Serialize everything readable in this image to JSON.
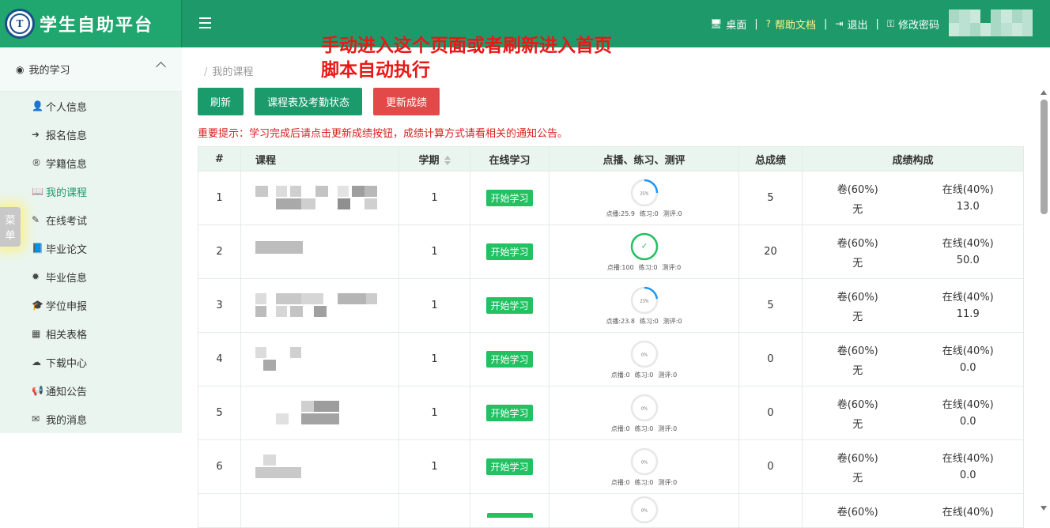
{
  "app": {
    "title": "学生自助平台",
    "logo_text": "T"
  },
  "topnav": {
    "desktop": "桌面",
    "help": "帮助文档",
    "logout": "退出",
    "change_password": "修改密码",
    "separator": "|"
  },
  "sidebar": {
    "section": "我的学习",
    "items": [
      {
        "label": "个人信息",
        "icon": "user-icon",
        "glyph": "👤"
      },
      {
        "label": "报名信息",
        "icon": "sign-in-icon",
        "glyph": "➜"
      },
      {
        "label": "学籍信息",
        "icon": "registered-icon",
        "glyph": "®"
      },
      {
        "label": "我的课程",
        "icon": "book-open-icon",
        "glyph": "📖"
      },
      {
        "label": "在线考试",
        "icon": "pencil-icon",
        "glyph": "✎"
      },
      {
        "label": "毕业论文",
        "icon": "book-icon",
        "glyph": "📘"
      },
      {
        "label": "毕业信息",
        "icon": "certificate-icon",
        "glyph": "✹"
      },
      {
        "label": "学位申报",
        "icon": "graduation-cap-icon",
        "glyph": "🎓"
      },
      {
        "label": "相关表格",
        "icon": "table-icon",
        "glyph": "▦"
      },
      {
        "label": "下载中心",
        "icon": "cloud-download-icon",
        "glyph": "☁"
      },
      {
        "label": "通知公告",
        "icon": "bullhorn-icon",
        "glyph": "📢"
      },
      {
        "label": "我的消息",
        "icon": "envelope-icon",
        "glyph": "✉"
      }
    ],
    "active_index": 3,
    "side_tab": {
      "line1": "菜",
      "line2": "单"
    }
  },
  "main": {
    "breadcrumb": "我的课程",
    "overlay_note_line1": "手动进入这个页面或者刷新进入首页",
    "overlay_note_line2": "脚本自动执行",
    "buttons": {
      "refresh": "刷新",
      "schedule": "课程表及考勤状态",
      "update_scores": "更新成绩"
    },
    "notice": "重要提示：学习完成后请点击更新成绩按钮，成绩计算方式请看相关的通知公告。",
    "table": {
      "headers": {
        "index": "#",
        "course": "课程",
        "term": "学期",
        "online": "在线学习",
        "progress": "点播、练习、测评",
        "total": "总成绩",
        "composition": "成绩构成"
      },
      "start_label": "开始学习",
      "rows": [
        {
          "index": "1",
          "term": "1",
          "pct": 25,
          "pct_label": "25%",
          "vod": "点播:25.9",
          "practice": "练习:0",
          "test": "测评:0",
          "total": "5",
          "exam_label": "卷(60%)",
          "exam_value": "无",
          "online_label": "在线(40%)",
          "online_value": "13.0"
        },
        {
          "index": "2",
          "term": "1",
          "pct": 100,
          "pct_label": "✓",
          "vod": "点播:100",
          "practice": "练习:0",
          "test": "测评:0",
          "total": "20",
          "exam_label": "卷(60%)",
          "exam_value": "无",
          "online_label": "在线(40%)",
          "online_value": "50.0"
        },
        {
          "index": "3",
          "term": "1",
          "pct": 23,
          "pct_label": "23%",
          "vod": "点播:23.8",
          "practice": "练习:0",
          "test": "测评:0",
          "total": "5",
          "exam_label": "卷(60%)",
          "exam_value": "无",
          "online_label": "在线(40%)",
          "online_value": "11.9"
        },
        {
          "index": "4",
          "term": "1",
          "pct": 0,
          "pct_label": "0%",
          "vod": "点播:0",
          "practice": "练习:0",
          "test": "测评:0",
          "total": "0",
          "exam_label": "卷(60%)",
          "exam_value": "无",
          "online_label": "在线(40%)",
          "online_value": "0.0"
        },
        {
          "index": "5",
          "term": "1",
          "pct": 0,
          "pct_label": "0%",
          "vod": "点播:0",
          "practice": "练习:0",
          "test": "测评:0",
          "total": "0",
          "exam_label": "卷(60%)",
          "exam_value": "无",
          "online_label": "在线(40%)",
          "online_value": "0.0"
        },
        {
          "index": "6",
          "term": "1",
          "pct": 0,
          "pct_label": "0%",
          "vod": "点播:0",
          "practice": "练习:0",
          "test": "测评:0",
          "total": "0",
          "exam_label": "卷(60%)",
          "exam_value": "无",
          "online_label": "在线(40%)",
          "online_value": "0.0"
        }
      ],
      "partial_row": {
        "pct_label": "0%",
        "exam_label": "卷(60%)",
        "online_label": "在线(40%)"
      }
    }
  },
  "colors": {
    "primary": "#1e9a6a",
    "danger": "#e24a4a",
    "badge": "#23c162",
    "notice": "#d91f1f",
    "progress": "#2196f3",
    "done": "#23c162"
  }
}
